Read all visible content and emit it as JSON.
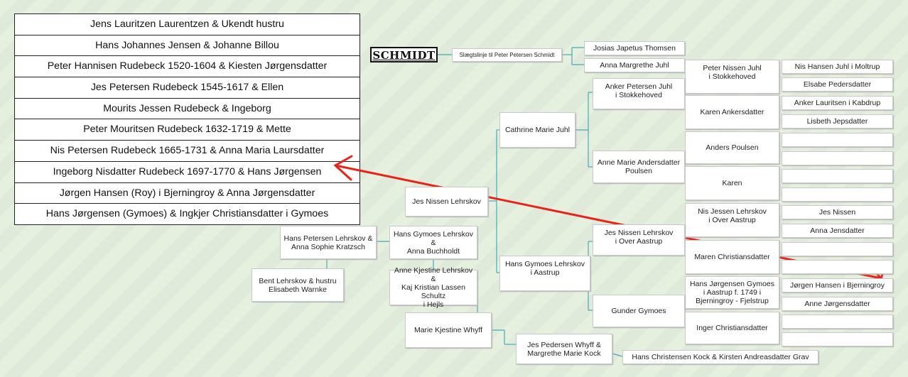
{
  "logo": "SCHMIDT",
  "left_list": [
    "Jens Lauritzen Laurentzen  &  Ukendt hustru",
    "Hans Johannes Jensen  &  Johanne Billou",
    "Peter Hannisen Rudebeck 1520-1604  &  Kiesten Jørgensdatter",
    "Jes Petersen Rudebeck 1545-1617  &  Ellen",
    "Mourits Jessen Rudebeck  &  Ingeborg",
    "Peter Mouritsen Rudebeck 1632-1719  &  Mette",
    "Nis Petersen Rudebeck 1665-1731  &  Anna Maria Laursdatter",
    "Ingeborg Nisdatter Rudebeck 1697-1770  &  Hans Jørgensen",
    "Jørgen Hansen (Roy) i Bjerningroy  &  Anna Jørgensdatter",
    "Hans Jørgensen (Gymoes)  &  Ingkjer Christiansdatter i Gymoes"
  ],
  "tree": {
    "slaegtslinje": "Slægtslinje til Peter Petersen Schmidt",
    "josias": "Josias Japetus Thomsen",
    "anna_margrethe": "Anna Margrethe Juhl",
    "peter_nissen": [
      "Peter Nissen Juhl",
      "i Stokkehoved"
    ],
    "nis_hansen": "Nis Hansen Juhl i Moltrup",
    "elsabe": "Elsabe Pedersdatter",
    "anker_petersen": [
      "Anker Petersen Juhl",
      "i Stokkehoved"
    ],
    "karen_ankers": "Karen Ankersdatter",
    "anker_lauritsen": "Anker Lauritsen i Kabdrup",
    "lisbeth": "Lisbeth Jepsdatter",
    "cathrine": "Cathrine Marie Juhl",
    "anders_poulsen": "Anders Poulsen",
    "anne_marie": [
      "Anne Marie Andersdatter",
      "Poulsen"
    ],
    "karen": "Karen",
    "jes_nissen_lehrskov_main": "Jes Nissen Lehrskov",
    "nis_jessen": [
      "Nis Jessen Lehrskov",
      "i Over Aastrup"
    ],
    "jes_nissen_name": "Jes Nissen",
    "anna_jensdatter": "Anna Jensdatter",
    "jes_nissen_over": [
      "Jes Nissen Lehrskov",
      "i    Over Aastrup"
    ],
    "maren": "Maren Christiansdatter",
    "hans_petersen": [
      "Hans Petersen Lehrskov &",
      "Anna Sophie Kratzsch"
    ],
    "hans_gymoes_buchholdt": [
      "Hans Gymoes Lehrskov &",
      "Anna Buchholdt"
    ],
    "hans_gymoes_aastrup": [
      "Hans Gymoes Lehrskov",
      "i Aastrup"
    ],
    "hans_jorgensen_gymoes": [
      "Hans Jørgensen Gymoes",
      "i Aastrup  f. 1749 i",
      "Bjerningroy - Fjelstrup"
    ],
    "jorgen_hansen": "Jørgen Hansen i Bjerningroy",
    "bent": [
      "Bent Lehrskov & hustru",
      "Elisabeth Warnke"
    ],
    "anne_kjestine": [
      "Anne Kjestine Lehrskov &",
      "Kaj Kristian Lassen Schultz",
      "i Hejls"
    ],
    "gunder": "Gunder Gymoes",
    "anne_jorgensdatter": "Anne Jørgensdatter",
    "inger": "Inger Christiansdatter",
    "marie_kjestine": "Marie Kjestine  Whyff",
    "jes_pedersen": [
      "Jes Pedersen Whyff &",
      "Margrethe Marie Kock"
    ],
    "hans_christensen": "Hans Christensen Kock & Kirsten Andreasdatter Grav"
  },
  "colors": {
    "arrow": "#e8231a",
    "line": "#46aab8",
    "background": "#e4efdd"
  }
}
